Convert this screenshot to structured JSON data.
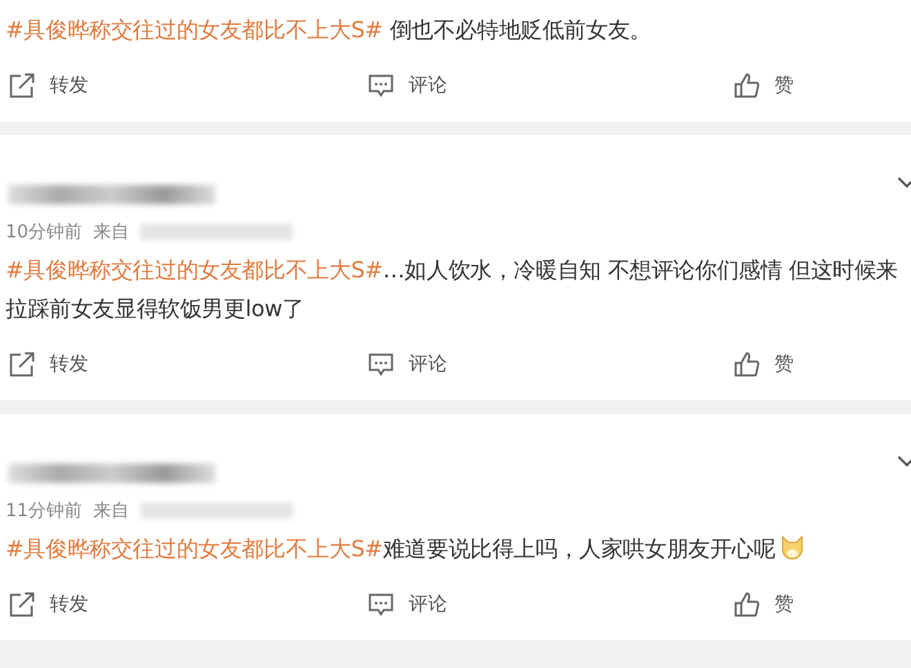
{
  "posts": [
    {
      "hashtag": "#具俊晔称交往过的女友都比不上大S#",
      "body": " 倒也不必特地贬低前女友。",
      "emoji": false,
      "actions": [
        "转发",
        "评论",
        "赞"
      ]
    },
    {
      "time": "10分钟前",
      "source_label": "来自",
      "hashtag": "#具俊晔称交往过的女友都比不上大S#",
      "body": "…如人饮水，冷暖自知 不想评论你们感情 但这时候来拉踩前女友显得软饭男更low了",
      "emoji": false,
      "actions": [
        "转发",
        "评论",
        "赞"
      ]
    },
    {
      "time": "11分钟前",
      "source_label": "来自",
      "hashtag": "#具俊晔称交往过的女友都比不上大S#",
      "body": "难道要说比得上吗，人家哄女朋友开心呢",
      "emoji": true,
      "actions": [
        "转发",
        "评论",
        "赞"
      ]
    }
  ]
}
